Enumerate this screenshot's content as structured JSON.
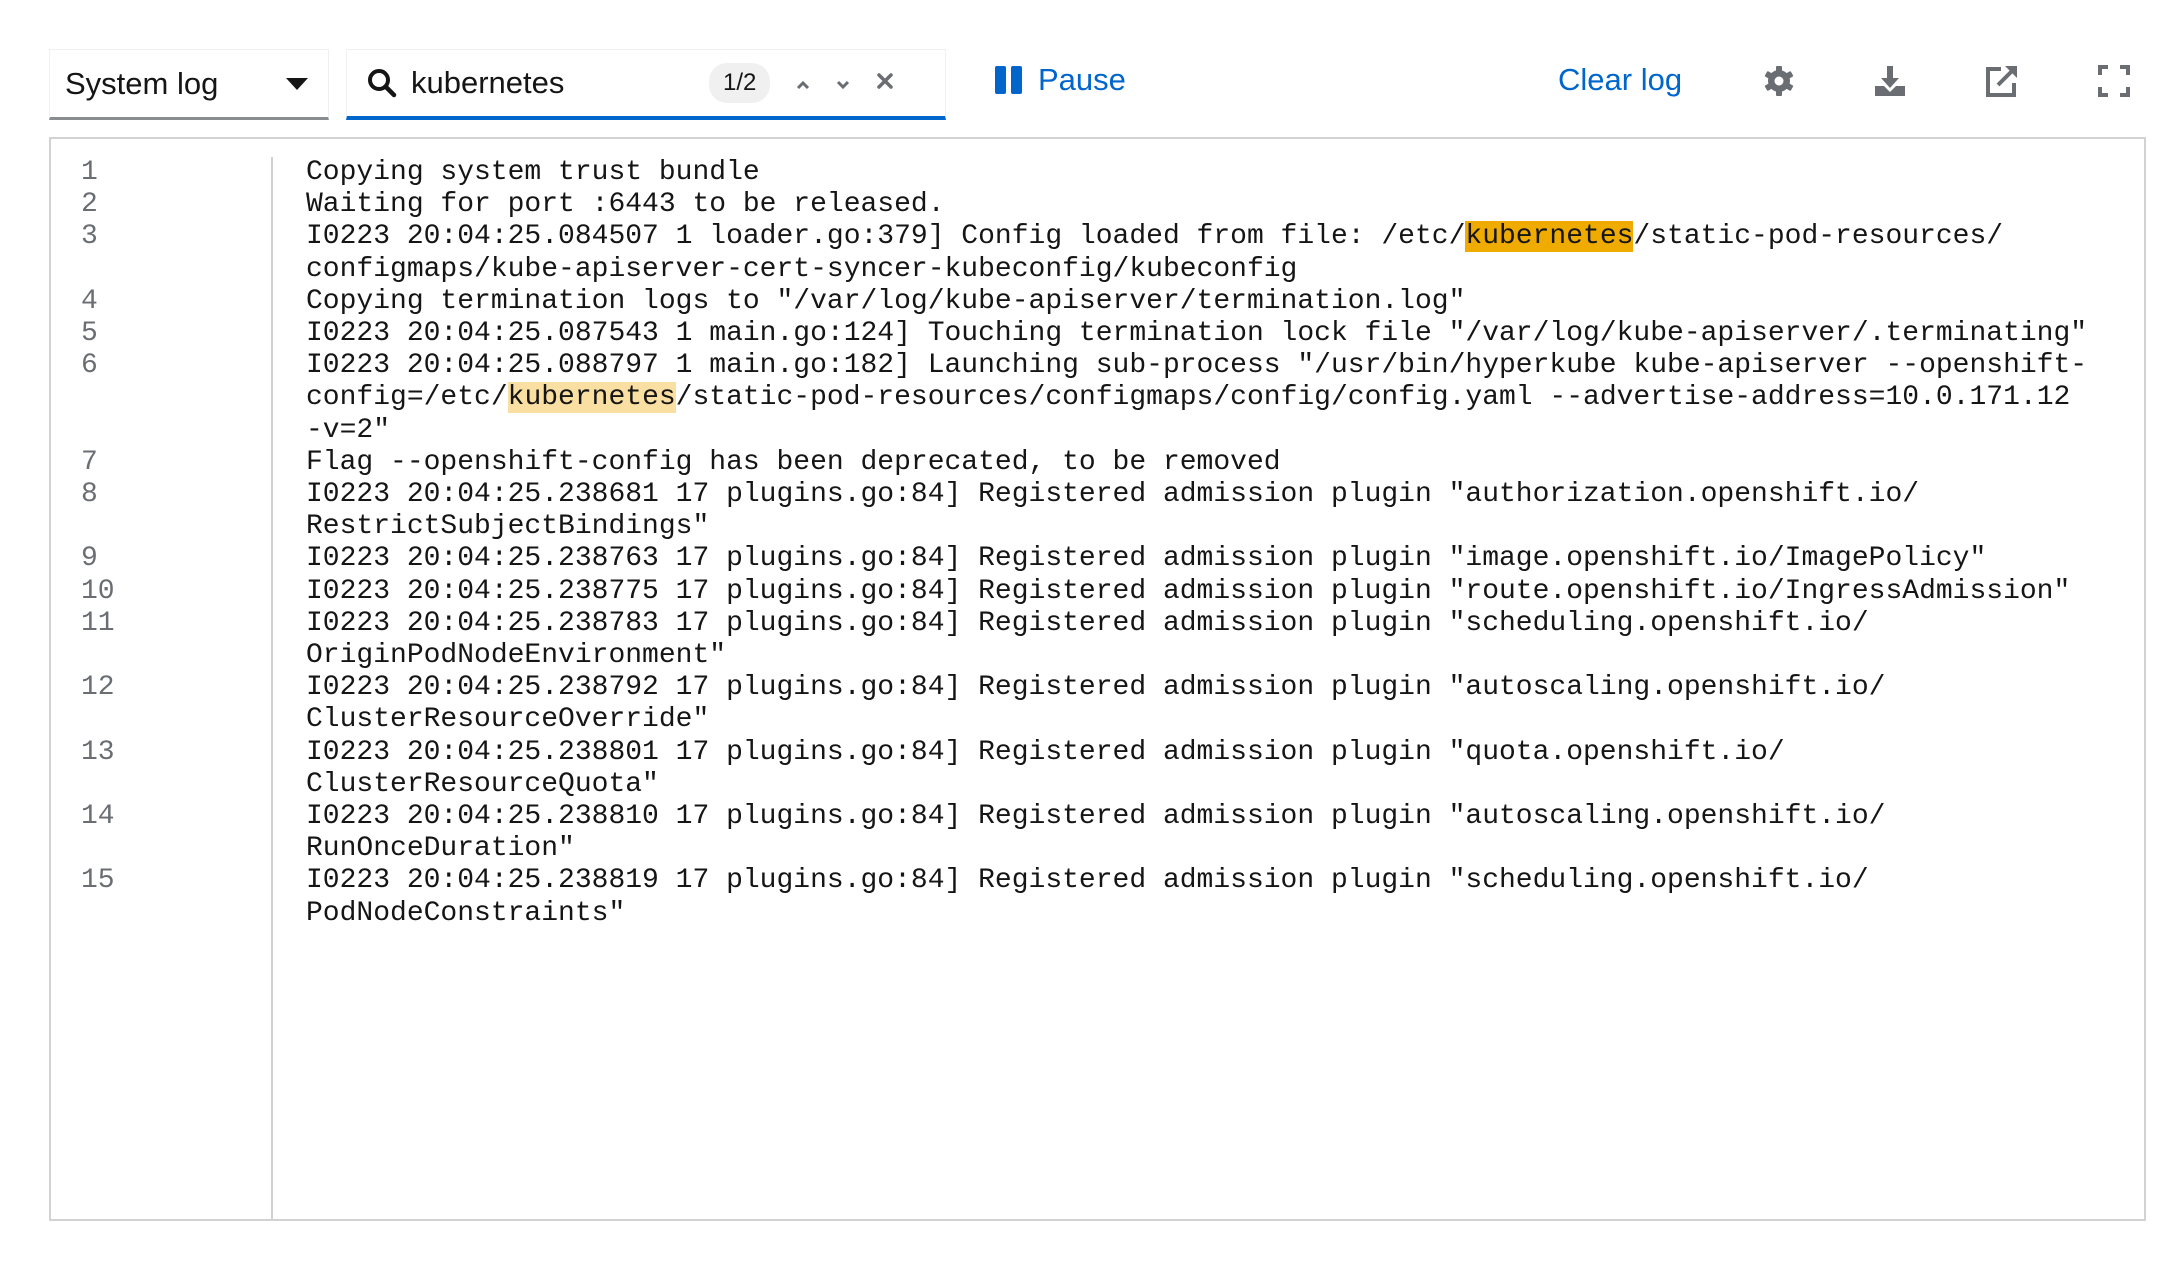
{
  "toolbar": {
    "log_select": "System log",
    "search": {
      "value": "kubernetes",
      "match_count": "1/2"
    },
    "pause_label": "Pause",
    "clear_label": "Clear log"
  },
  "colors": {
    "accent": "#0066cc",
    "current_match": "#f0ab00",
    "match": "#f9e0a2"
  },
  "log": {
    "search_term": "kubernetes",
    "lines": [
      {
        "n": "1",
        "rows": [
          "Copying system trust bundle"
        ]
      },
      {
        "n": "2",
        "rows": [
          "Waiting for port :6443 to be released."
        ]
      },
      {
        "n": "3",
        "rows": [
          "I0223 20:04:25.084507 1 loader.go:379] Config loaded from file: /etc/kubernetes/static-pod-resources/",
          "configmaps/kube-apiserver-cert-syncer-kubeconfig/kubeconfig"
        ]
      },
      {
        "n": "4",
        "rows": [
          "Copying termination logs to \"/var/log/kube-apiserver/termination.log\""
        ]
      },
      {
        "n": "5",
        "rows": [
          "I0223 20:04:25.087543 1 main.go:124] Touching termination lock file \"/var/log/kube-apiserver/.terminating\""
        ]
      },
      {
        "n": "6",
        "rows": [
          "I0223 20:04:25.088797 1 main.go:182] Launching sub-process \"/usr/bin/hyperkube kube-apiserver --openshift-",
          "config=/etc/kubernetes/static-pod-resources/configmaps/config/config.yaml --advertise-address=10.0.171.12",
          "-v=2\""
        ]
      },
      {
        "n": "7",
        "rows": [
          "Flag --openshift-config has been deprecated, to be removed"
        ]
      },
      {
        "n": "8",
        "rows": [
          "I0223 20:04:25.238681 17 plugins.go:84] Registered admission plugin \"authorization.openshift.io/",
          "RestrictSubjectBindings\""
        ]
      },
      {
        "n": "9",
        "rows": [
          "I0223 20:04:25.238763 17 plugins.go:84] Registered admission plugin \"image.openshift.io/ImagePolicy\""
        ]
      },
      {
        "n": "10",
        "rows": [
          "I0223 20:04:25.238775 17 plugins.go:84] Registered admission plugin \"route.openshift.io/IngressAdmission\""
        ]
      },
      {
        "n": "11",
        "rows": [
          "I0223 20:04:25.238783 17 plugins.go:84] Registered admission plugin \"scheduling.openshift.io/",
          "OriginPodNodeEnvironment\""
        ]
      },
      {
        "n": "12",
        "rows": [
          "I0223 20:04:25.238792 17 plugins.go:84] Registered admission plugin \"autoscaling.openshift.io/",
          "ClusterResourceOverride\""
        ]
      },
      {
        "n": "13",
        "rows": [
          "I0223 20:04:25.238801 17 plugins.go:84] Registered admission plugin \"quota.openshift.io/",
          "ClusterResourceQuota\""
        ]
      },
      {
        "n": "14",
        "rows": [
          "I0223 20:04:25.238810 17 plugins.go:84] Registered admission plugin \"autoscaling.openshift.io/",
          "RunOnceDuration\""
        ]
      },
      {
        "n": "15",
        "rows": [
          "I0223 20:04:25.238819 17 plugins.go:84] Registered admission plugin \"scheduling.openshift.io/",
          "PodNodeConstraints\""
        ]
      }
    ]
  }
}
